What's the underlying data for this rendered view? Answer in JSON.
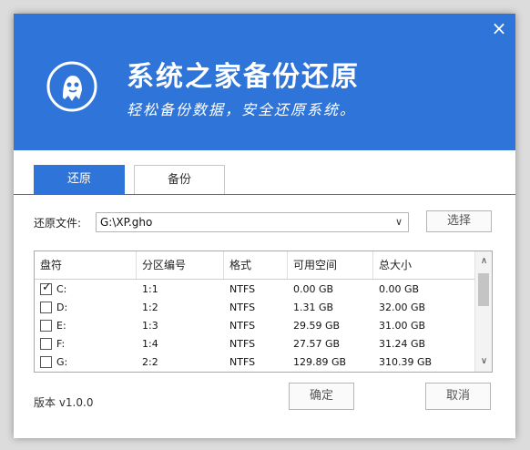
{
  "header": {
    "title": "系统之家备份还原",
    "subtitle": "轻松备份数据，安全还原系统。",
    "bg_color": "#2f74d8"
  },
  "window": {
    "close_label": "×"
  },
  "tabs": [
    {
      "label": "还原",
      "active": true
    },
    {
      "label": "备份",
      "active": false
    }
  ],
  "restore_file": {
    "label": "还原文件:",
    "value": "G:\\XP.gho",
    "arrow": "∨",
    "browse_label": "选择"
  },
  "table": {
    "columns": [
      "盘符",
      "分区编号",
      "格式",
      "可用空间",
      "总大小"
    ],
    "rows": [
      {
        "checked": true,
        "drive": "C:",
        "partition": "1:1",
        "format": "NTFS",
        "free": "0.00 GB",
        "total": "0.00 GB"
      },
      {
        "checked": false,
        "drive": "D:",
        "partition": "1:2",
        "format": "NTFS",
        "free": "1.31 GB",
        "total": "32.00 GB"
      },
      {
        "checked": false,
        "drive": "E:",
        "partition": "1:3",
        "format": "NTFS",
        "free": "29.59 GB",
        "total": "31.00 GB"
      },
      {
        "checked": false,
        "drive": "F:",
        "partition": "1:4",
        "format": "NTFS",
        "free": "27.57 GB",
        "total": "31.24 GB"
      },
      {
        "checked": false,
        "drive": "G:",
        "partition": "2:2",
        "format": "NTFS",
        "free": "129.89 GB",
        "total": "310.39 GB"
      }
    ]
  },
  "footer": {
    "version": "版本 v1.0.0",
    "ok_label": "确定",
    "cancel_label": "取消"
  }
}
